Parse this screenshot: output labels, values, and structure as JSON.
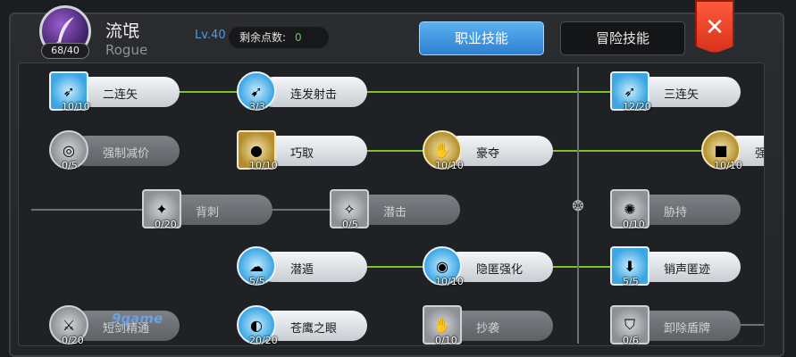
{
  "header": {
    "class_name": "流氓",
    "class_name_en": "Rogue",
    "level": "Lv.40",
    "skill_points_progress": "68/40",
    "remaining_points_label": "剩余点数:",
    "remaining_points_value": "0",
    "icon": "feather-quill-icon"
  },
  "tabs": [
    {
      "label": "职业技能",
      "active": true
    },
    {
      "label": "冒险技能",
      "active": false
    }
  ],
  "close_label": "✕",
  "colors": {
    "active_tab": "#3b8fde",
    "close": "#e8402a",
    "link_line": "#76c52b",
    "lock_line": "#6d7075"
  },
  "skills": [
    {
      "name": "二连矢",
      "level": "10/10",
      "icon": "double-arrow-icon",
      "learned": true
    },
    {
      "name": "连发射击",
      "level": "3/3",
      "icon": "rapid-shot-icon",
      "learned": true
    },
    {
      "name": "三连矢",
      "level": "12/20",
      "icon": "triple-arrow-icon",
      "learned": true
    },
    {
      "name": "强制减价",
      "level": "0/5",
      "icon": "coins-icon",
      "learned": false
    },
    {
      "name": "巧取",
      "level": "10/10",
      "icon": "snatch-icon",
      "learned": true
    },
    {
      "name": "豪夺",
      "level": "10/10",
      "icon": "plunder-icon",
      "learned": true
    },
    {
      "name": "强",
      "level": "10/10",
      "icon": "strong-icon",
      "learned": true
    },
    {
      "name": "背刺",
      "level": "0/20",
      "icon": "backstab-icon",
      "learned": false
    },
    {
      "name": "潜击",
      "level": "0/5",
      "icon": "sneak-attack-icon",
      "learned": false
    },
    {
      "name": "胁持",
      "level": "0/10",
      "icon": "hostage-icon",
      "learned": false
    },
    {
      "name": "潜遁",
      "level": "5/5",
      "icon": "hide-icon",
      "learned": true
    },
    {
      "name": "隐匿强化",
      "level": "10/10",
      "icon": "stealth-boost-icon",
      "learned": true
    },
    {
      "name": "销声匿迹",
      "level": "5/5",
      "icon": "vanish-icon",
      "learned": true
    },
    {
      "name": "短剑精通",
      "level": "0/20",
      "icon": "dagger-icon",
      "learned": false
    },
    {
      "name": "苍鹰之眼",
      "level": "20/20",
      "icon": "eagle-eye-icon",
      "learned": true
    },
    {
      "name": "抄袭",
      "level": "0/10",
      "icon": "plagiarize-icon",
      "learned": false
    },
    {
      "name": "卸除盾牌",
      "level": "0/6",
      "icon": "strip-shield-icon",
      "learned": false
    }
  ],
  "watermark": "9game"
}
